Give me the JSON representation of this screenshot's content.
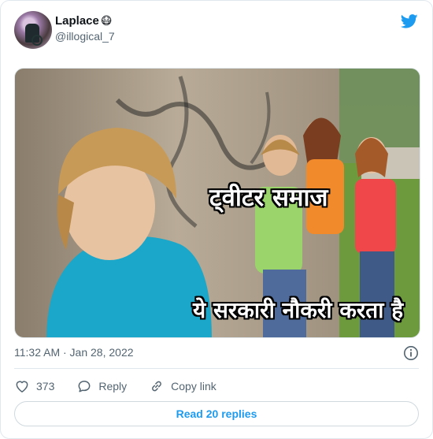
{
  "tweet": {
    "author": {
      "display_name": "Laplace",
      "name_emoji": "😷",
      "handle": "@illogical_7"
    },
    "platform_icon": "twitter-bird-icon",
    "brand_color": "#1d9bf0",
    "media": {
      "caption_top": "ट्वीटर समाज",
      "caption_bottom": "ये सरकारी नौकरी करता है"
    },
    "timestamp": "11:32 AM · Jan 28, 2022",
    "info_icon": "info-icon",
    "actions": {
      "like_count": "373",
      "reply_label": "Reply",
      "copy_link_label": "Copy link"
    },
    "read_replies_label": "Read 20 replies"
  }
}
